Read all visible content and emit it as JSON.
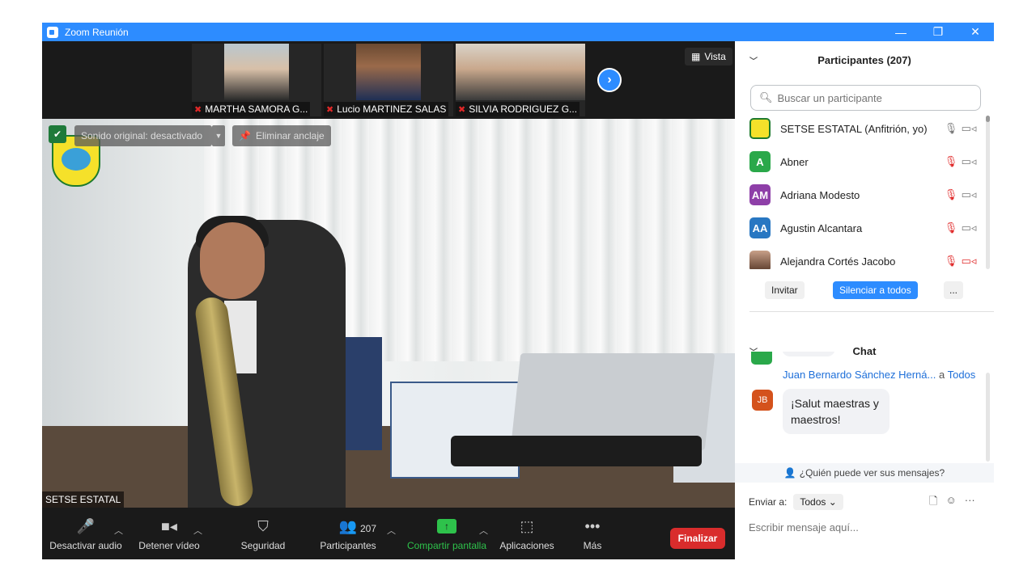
{
  "window": {
    "title": "Zoom Reunión",
    "minimize": "—",
    "restore": "❐",
    "close": "✕"
  },
  "video": {
    "tiles": [
      {
        "name": "MARTHA SAMORA G...",
        "mic_muted": true
      },
      {
        "name": "Lucio MARTINEZ SALAS",
        "mic_muted": true
      },
      {
        "name": "SILVIA RODRIGUEZ G...",
        "mic_muted": true
      }
    ],
    "next_icon": "›",
    "view_label": "Vista",
    "original_sound": "Sonido original: desactivado",
    "unpin": "Eliminar anclaje",
    "main_speaker_label": "SETSE ESTATAL"
  },
  "toolbar": {
    "mute_audio": "Desactivar audio",
    "stop_video": "Detener vídeo",
    "security": "Seguridad",
    "participants": "Participantes",
    "participant_count": "207",
    "share_screen": "Compartir pantalla",
    "apps": "Aplicaciones",
    "more": "Más",
    "end": "Finalizar"
  },
  "participants_panel": {
    "title": "Participantes (207)",
    "search_placeholder": "Buscar un participante",
    "list": [
      {
        "name": "SETSE ESTATAL (Anfitrión, yo)",
        "initials": "",
        "color": "#f5e12a",
        "mic_muted": false,
        "video_off": false
      },
      {
        "name": "Abner",
        "initials": "A",
        "color": "#2aa84a",
        "mic_muted": true,
        "video_off": false
      },
      {
        "name": "Adriana Modesto",
        "initials": "AM",
        "color": "#8e3fa8",
        "mic_muted": true,
        "video_off": false
      },
      {
        "name": "Agustin Alcantara",
        "initials": "AA",
        "color": "#2877c2",
        "mic_muted": true,
        "video_off": false
      },
      {
        "name": "Alejandra Cortés Jacobo",
        "initials": "",
        "color": "#8a6a5a",
        "mic_muted": true,
        "video_off": true
      }
    ],
    "invite": "Invitar",
    "mute_all": "Silenciar a todos",
    "more": "..."
  },
  "chat_panel": {
    "title": "Chat",
    "sender": "Juan Bernardo Sánchez Herná...",
    "to_word": "a",
    "recipient": "Todos",
    "sender_initials": "JB",
    "sender_color": "#d4521c",
    "message": "¡Salut maestras y maestros!",
    "who_sees": "¿Quién puede ver sus mensajes?",
    "send_to_label": "Enviar a:",
    "send_to_value": "Todos",
    "input_placeholder": "Escribir mensaje aquí..."
  }
}
